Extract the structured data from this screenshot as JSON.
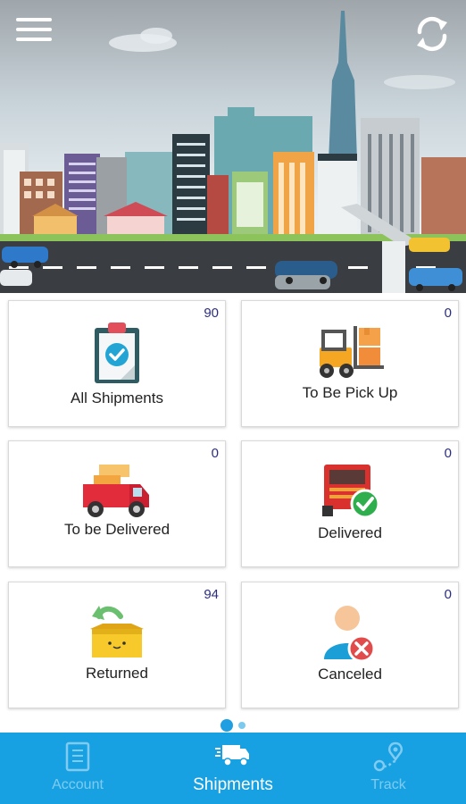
{
  "header": {
    "menu_icon": "hamburger-menu-icon",
    "refresh_icon": "refresh-icon"
  },
  "cards": [
    {
      "label": "All Shipments",
      "count": "90",
      "icon": "clipboard-check-icon"
    },
    {
      "label": "To Be Pick Up",
      "count": "0",
      "icon": "forklift-icon"
    },
    {
      "label": "To be Delivered",
      "count": "0",
      "icon": "delivery-truck-icon"
    },
    {
      "label": "Delivered",
      "count": "0",
      "icon": "truck-check-icon"
    },
    {
      "label": "Returned",
      "count": "94",
      "icon": "return-box-icon"
    },
    {
      "label": "Canceled",
      "count": "0",
      "icon": "user-cancel-icon"
    }
  ],
  "pager": {
    "pages": 2,
    "current": 1
  },
  "bottom_nav": {
    "items": [
      {
        "label": "Account",
        "icon": "document-icon",
        "active": false
      },
      {
        "label": "Shipments",
        "icon": "truck-icon",
        "active": true
      },
      {
        "label": "Track",
        "icon": "route-pin-icon",
        "active": false
      }
    ]
  },
  "colors": {
    "accent": "#17a1e3",
    "count_text": "#2b2d7e"
  }
}
